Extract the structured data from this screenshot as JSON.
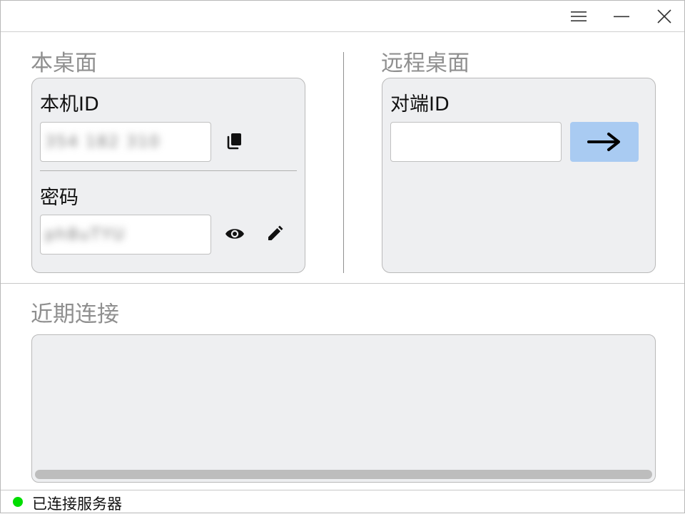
{
  "titlebar": {
    "menu_icon": "hamburger-menu-icon",
    "minimize_icon": "minimize-icon",
    "close_icon": "close-icon"
  },
  "local": {
    "section_title": "本桌面",
    "id_label": "本机ID",
    "id_value": "354 182 310",
    "password_label": "密码",
    "password_value": "ph8uTYU",
    "copy_icon": "copy-icon",
    "show_icon": "eye-icon",
    "edit_icon": "pencil-icon"
  },
  "remote": {
    "section_title": "远程桌面",
    "peer_id_label": "对端ID",
    "peer_id_value": "",
    "connect_icon": "arrow-right-icon"
  },
  "recent": {
    "section_title": "近期连接"
  },
  "status": {
    "text": "已连接服务器",
    "dot_color": "#00dd00"
  },
  "colors": {
    "connect_button": "#a9cbf2",
    "card_background": "#eeeff1"
  }
}
